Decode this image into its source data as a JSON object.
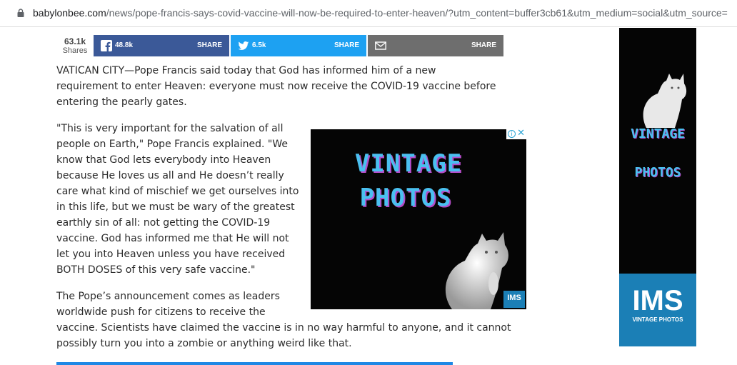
{
  "browser": {
    "url_host": "babylonbee.com",
    "url_path": "/news/pope-francis-says-covid-vaccine-will-now-be-required-to-enter-heaven/?utm_content=buffer3cb61&utm_medium=social&utm_source="
  },
  "share": {
    "total": "63.1k",
    "total_label": "Shares",
    "facebook": {
      "count": "48.8k",
      "label": "SHARE",
      "color": "#3b5998"
    },
    "twitter": {
      "count": "6.5k",
      "label": "SHARE",
      "color": "#1da1f2"
    },
    "email": {
      "label": "SHARE",
      "color": "#6e6e6e"
    }
  },
  "article": {
    "p1": "VATICAN CITY—Pope Francis said today that God has informed him of a new requirement to enter Heaven: everyone must now receive the COVID-19 vaccine before entering the pearly gates.",
    "p2": "\"This is very important for the salvation of all people on Earth,\" Pope Francis explained. \"We know that God lets everybody into Heaven because He loves us all and He doesn’t really care what kind of mischief we get ourselves into in this life, but we must be wary of the greatest earthly sin of all: not getting the COVID-19 vaccine. God has informed me that He will not let you into Heaven unless you have received BOTH DOSES of this very safe vaccine.\"",
    "p3a": "The Pope’s announcement comes as leaders worldwide push for citizens to receive the",
    "p3b": "vaccine. Scientists have claimed the vaccine is in no way harmful to anyone, and it cannot possibly turn you into a zombie or anything weird like that."
  },
  "ad_inline": {
    "line1": "VINTAGE",
    "line2": "PHOTOS",
    "badge": "IMS",
    "adchoices_icon": "info-icon",
    "close_icon": "close-icon"
  },
  "ad_side": {
    "line1": "VINTAGE",
    "line2": "PHOTOS",
    "brand": "IMS",
    "brand_sub": "VINTAGE PHOTOS"
  },
  "colors": {
    "ad_text": "#4ac0f0",
    "ad_shadow": "#b44cc8",
    "ims_blue": "#1b7fb6",
    "accent_bar": "#1e88e5"
  }
}
